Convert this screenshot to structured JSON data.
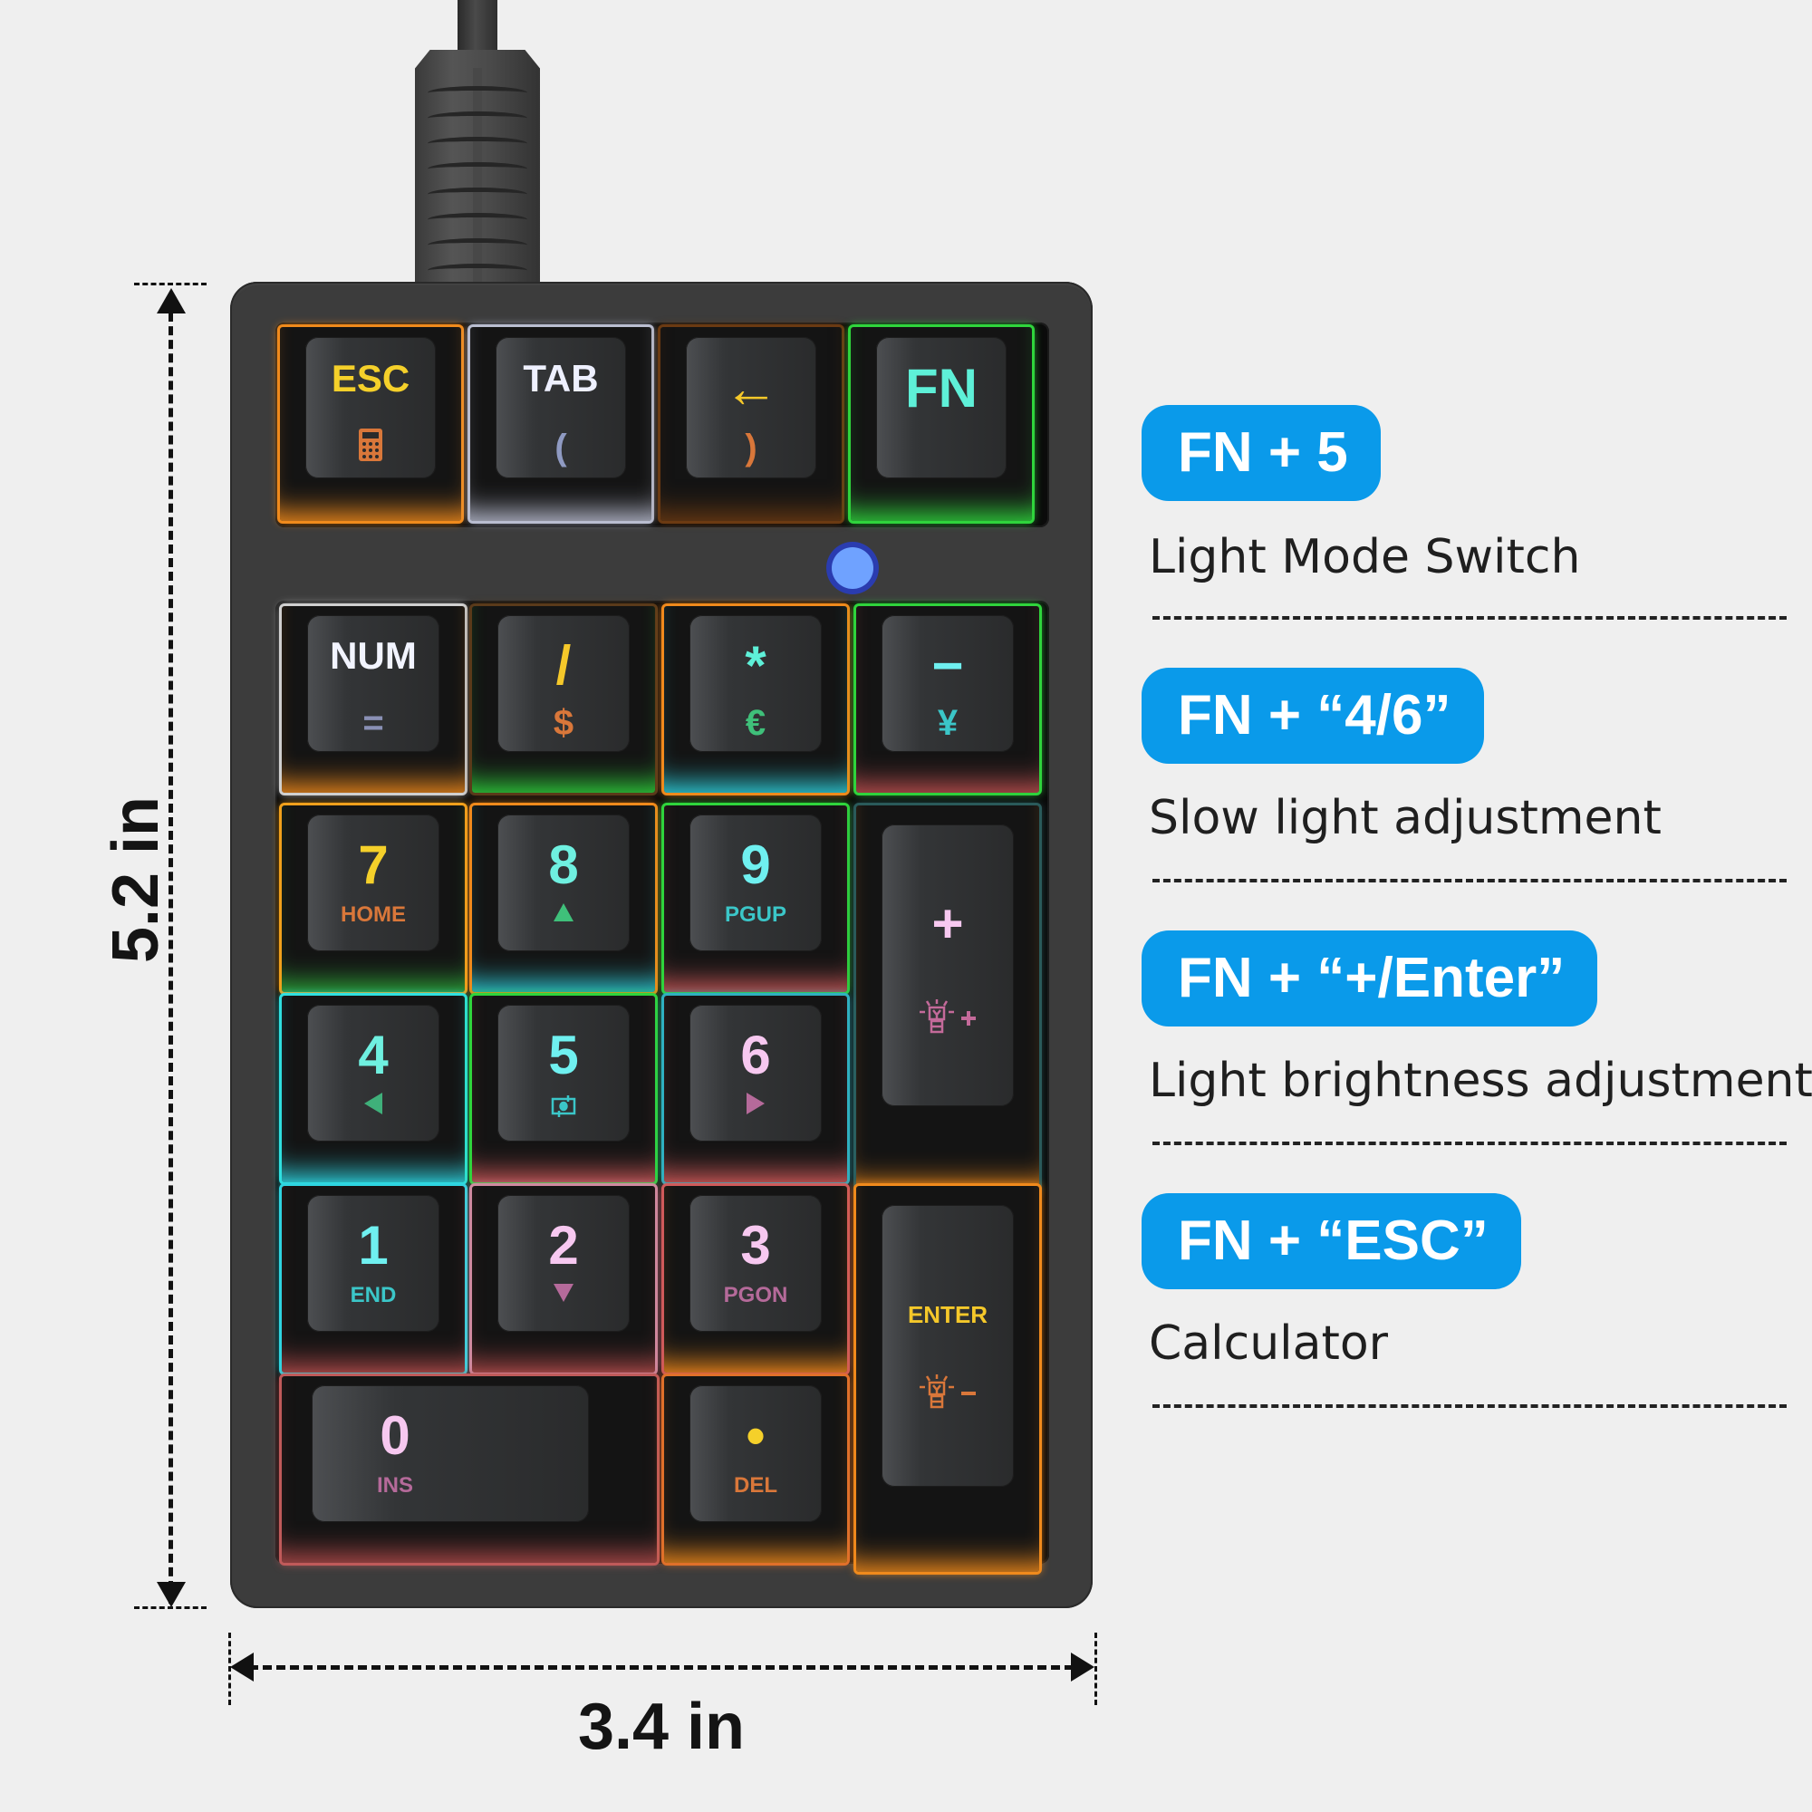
{
  "dimensions": {
    "height_label": "5.2 in",
    "width_label": "3.4 in"
  },
  "keypad": {
    "top_row": [
      {
        "main": "ESC",
        "sub_icon": "calculator-icon",
        "main_color": "#f5d02a",
        "sub_color": "#d9773a",
        "glow": "#f08a1c"
      },
      {
        "main": "TAB",
        "sub": "(",
        "main_color": "#eef0ff",
        "sub_color": "#8f9ac2",
        "glow": "#b9bdd0"
      },
      {
        "main": "←",
        "sub": ")",
        "main_color": "#f5c82a",
        "sub_color": "#d9773a",
        "glow": "#6b3a12"
      },
      {
        "main": "FN",
        "main_color": "#5ef0d8",
        "glow": "#2fd43c"
      }
    ],
    "keys": [
      {
        "id": "num",
        "main": "NUM",
        "sub": "=",
        "main_color": "#f2f4ff",
        "sub_color": "#8a90b5",
        "glow": "#d0d0d0",
        "glow2": "#f08a1c"
      },
      {
        "id": "slash",
        "main": "/",
        "sub": "$",
        "main_color": "#f5c82a",
        "sub_color": "#d9773a",
        "glow": "#5a3a1a",
        "glow2": "#2fd43c"
      },
      {
        "id": "asterisk",
        "main": "*",
        "sub": "€",
        "main_color": "#5ef0d8",
        "sub_color": "#3fc07a",
        "glow": "#f08a1c",
        "glow2": "#2fd4e0"
      },
      {
        "id": "minus",
        "main": "−",
        "sub": "¥",
        "main_color": "#6ff0f0",
        "sub_color": "#3bc6c8",
        "glow": "#2fd43c",
        "glow2": "#c05050"
      },
      {
        "id": "7",
        "main": "7",
        "sub": "HOME",
        "main_color": "#f5d02a",
        "sub_color": "#d9773a",
        "glow": "#f0a01c",
        "glow2": "#2fb03c"
      },
      {
        "id": "8",
        "main": "8",
        "sub_icon": "up-triangle-icon",
        "main_color": "#6ff0e0",
        "sub_color": "#3fc07a",
        "glow": "#f08a1c",
        "glow2": "#2fd4e0"
      },
      {
        "id": "9",
        "main": "9",
        "sub": "PGUP",
        "main_color": "#6ff0f0",
        "sub_color": "#3bc6c8",
        "glow": "#2fd43c",
        "glow2": "#d05a5a"
      },
      {
        "id": "plus",
        "main": "+",
        "sub_icon": "brightness-up-icon",
        "main_color": "#f7c8f0",
        "sub_color": "#c46a9a",
        "glow": "#2a5a5a",
        "glow2": "#f08a1c"
      },
      {
        "id": "4",
        "main": "4",
        "sub_icon": "left-triangle-icon",
        "main_color": "#6ff0e0",
        "sub_color": "#3fb07a",
        "glow": "#2fe0e0",
        "glow2": "#2fd4e0"
      },
      {
        "id": "5",
        "main": "5",
        "sub_icon": "light-mode-icon",
        "main_color": "#6ff0f0",
        "sub_color": "#3bc6c8",
        "glow": "#2fd43c",
        "glow2": "#d05a5a"
      },
      {
        "id": "6",
        "main": "6",
        "sub_icon": "right-triangle-icon",
        "main_color": "#f7c8f0",
        "sub_color": "#b56a9a",
        "glow": "#2fb0c0",
        "glow2": "#d05a5a"
      },
      {
        "id": "1",
        "main": "1",
        "sub": "END",
        "main_color": "#6ff0f0",
        "sub_color": "#3bc6c8",
        "glow": "#2fd4e0",
        "glow2": "#b04a4a"
      },
      {
        "id": "2",
        "main": "2",
        "sub_icon": "down-triangle-icon",
        "main_color": "#f7c8f0",
        "sub_color": "#b56a9a",
        "glow": "#d08aa0",
        "glow2": "#b04a4a"
      },
      {
        "id": "3",
        "main": "3",
        "sub": "PGON",
        "main_color": "#f7c8f0",
        "sub_color": "#b56a9a",
        "glow": "#d05a5a",
        "glow2": "#f08a1c"
      },
      {
        "id": "enter",
        "main": "ENTER",
        "sub_icon": "brightness-down-icon",
        "main_color": "#f5c82a",
        "sub_color": "#d9773a",
        "glow": "#f08a1c",
        "glow2": "#f08a1c"
      },
      {
        "id": "0",
        "main": "0",
        "sub": "INS",
        "main_color": "#f7c8f0",
        "sub_color": "#b56a9a",
        "glow": "#c05a5a",
        "glow2": "#b04a4a"
      },
      {
        "id": "dot",
        "main": "•",
        "sub": "DEL",
        "main_color": "#f5d02a",
        "sub_color": "#d9773a",
        "glow": "#e0702a",
        "glow2": "#f08a1c"
      }
    ],
    "indicator_led_color": "#6fa2ff"
  },
  "shortcuts": [
    {
      "combo": "FN + 5",
      "description": "Light Mode Switch"
    },
    {
      "combo": "FN + “4/6”",
      "description": "Slow light adjustment"
    },
    {
      "combo": "FN + “+/Enter”",
      "description": "Light brightness adjustment"
    },
    {
      "combo": "FN + “ESC”",
      "description": "Calculator"
    }
  ],
  "colors": {
    "badge": "#0a9aea",
    "background": "#efefef",
    "frame": "#3c3c3c"
  }
}
